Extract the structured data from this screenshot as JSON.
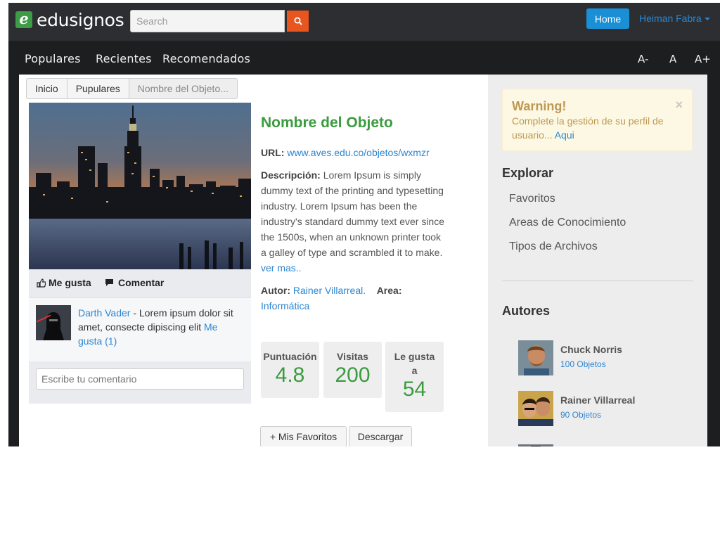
{
  "brand": {
    "logo_letter": "e",
    "name": "edusignos"
  },
  "search": {
    "placeholder": "Search"
  },
  "header": {
    "home_label": "Home",
    "user_name": "Heiman Fabra"
  },
  "nav": {
    "items": [
      "Populares",
      "Recientes",
      "Recomendados"
    ],
    "font_controls": [
      "A-",
      "A",
      "A+"
    ]
  },
  "breadcrumb": [
    "Inicio",
    "Pupulares",
    "Nombre del Objeto..."
  ],
  "actions": {
    "like": "Me gusta",
    "comment": "Comentar"
  },
  "comment": {
    "author": "Darth Vader",
    "text": " - Lorem ipsum dolor sit amet, consecte dipiscing elit ",
    "likes": "Me gusta (1)"
  },
  "reply": {
    "placeholder": "Escribe tu comentario"
  },
  "object": {
    "title": "Nombre del Objeto",
    "url_label": "URL:",
    "url": "www.aves.edu.co/objetos/wxmzr",
    "description_label": "Descripción:",
    "description": " Lorem Ipsum is simply dummy text of the printing and typesetting industry. Lorem Ipsum has been the industry's standard dummy text ever since the 1500s, when an unknown printer took a galley of type and scrambled it to make.",
    "more": "ver mas..",
    "author_label": "Autor:",
    "author": "Rainer Villarreal.",
    "area_label": "Area:",
    "area": "Informática"
  },
  "stats": [
    {
      "label": "Puntuación",
      "value": "4.8"
    },
    {
      "label": "Visitas",
      "value": "200"
    },
    {
      "label": "Le gusta a",
      "value": "54"
    }
  ],
  "buttons": {
    "favorites": "+ Mis Favoritos",
    "download": "Descargar"
  },
  "warning": {
    "title": "Warning!",
    "text": "Complete la gestión de su perfil de usuario... ",
    "link": "Aqui",
    "close": "×"
  },
  "explore": {
    "heading": "Explorar",
    "links": [
      "Favoritos",
      "Areas de Conocimiento",
      "Tipos de Archivos"
    ]
  },
  "authors": {
    "heading": "Autores",
    "items": [
      {
        "name": "Chuck Norris",
        "count": "100 Objetos"
      },
      {
        "name": "Rainer Villarreal",
        "count": "90 Objetos"
      }
    ]
  },
  "colors": {
    "accent_green": "#3b9b3f",
    "link_blue": "#2b86d1",
    "home_blue": "#1a8fd6",
    "search_orange": "#e8551f"
  }
}
